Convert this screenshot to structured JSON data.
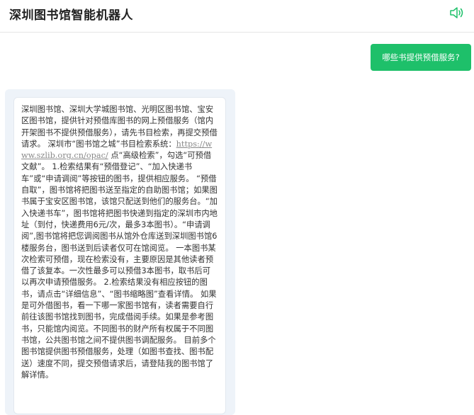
{
  "header": {
    "title": "深圳图书馆智能机器人",
    "speaker_icon": "speaker-icon",
    "accent_color": "#1ec06a"
  },
  "chat": {
    "user_message": "哪些书提供预借服务?",
    "bot_answer": {
      "part1": "深圳图书馆、深圳大学城图书馆、光明区图书馆、宝安区图书馆，提供针对预借库图书的网上预借服务（馆内开架图书不提供预借服务），请先书目检索，再提交预借请求。 深圳市“图书馆之城”书目检索系统：",
      "link": "https://www.szlib.org.cn/opac/",
      "part2": " 点“高级检索”，勾选“可预借文献”。 1.检索结果有“预借登记”、“加入快递书车”或“申请调阅”等按钮的图书，提供相应服务。 “预借自取”，图书馆将把图书送至指定的自助图书馆；如果图书属于宝安区图书馆，该馆只配送到他们的服务台。“加入快递书车”，图书馆将把图书快递到指定的深圳市内地址（到付，快递费用6元/次，最多3本图书）。“申请调阅”,图书馆将把您调阅图书从馆外仓库送到深圳图书馆6楼服务台，图书送到后读者仅可在馆阅览。 一本图书某次检索可预借，现在检索没有，主要原因是其他读者预借了该复本。一次性最多可以预借3本图书，取书后可以再次申请预借服务。 2.检索结果没有相应按钮的图书，请点击“详细信息”、“图书缩略图”查看详情。 如果是可外借图书，看一下哪一家图书馆有，读者需要自行前往该图书馆找到图书，完成借阅手续。如果是参考图书，只能馆内阅览。不同图书的财产所有权属于不同图书馆，公共图书馆之间不提供图书调配服务。 目前多个图书馆提供图书预借服务，处理（如图书查找、图书配送）速度不同，提交预借请求后，请登陆我的图书馆了解详情。"
    }
  }
}
